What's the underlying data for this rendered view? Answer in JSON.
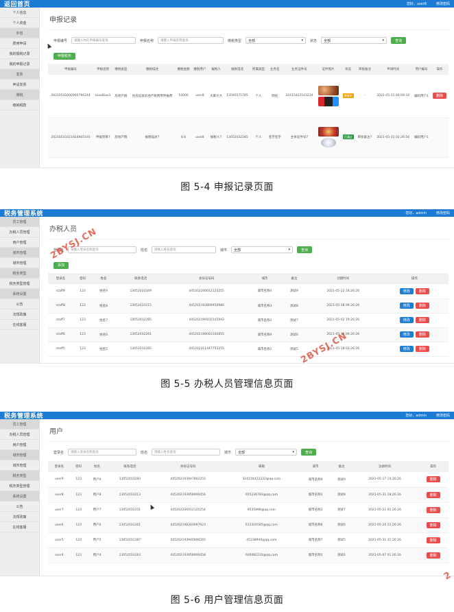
{
  "shot1": {
    "title": "返回首页",
    "top_right": [
      "您好，user8",
      "修改密码"
    ],
    "sidebar": [
      {
        "label": "个人信息",
        "group": false
      },
      {
        "label": "个人资金",
        "group": false
      },
      {
        "label": "外包",
        "group": true
      },
      {
        "label": "费用申请",
        "group": false
      },
      {
        "label": "我的报税记录",
        "group": false
      },
      {
        "label": "我的申报记录",
        "group": false
      },
      {
        "label": "发票",
        "group": true
      },
      {
        "label": "申请发票",
        "group": false
      },
      {
        "label": "缴税",
        "group": true
      },
      {
        "label": "缴纳税款",
        "group": false
      }
    ],
    "page_title": "申报记录",
    "filters": {
      "f1_label": "申报编号",
      "f1_placeholder": "请输入你的申报编号查询",
      "f2_label": "申报名称",
      "f2_placeholder": "请输入申报名称查询",
      "f3_label": "缴税类型",
      "f3_value": "全部",
      "f4_label": "状态",
      "f4_value": "全部",
      "search_label": "查询",
      "add_label": "申报税务"
    },
    "columns": [
      "申报编号",
      "申报名称",
      "缴税类型",
      "缴税描述",
      "缴税金额",
      "缴税用户",
      "报税人",
      "报税电话",
      "所属类型",
      "业务名",
      "业务证件号",
      "证件照片",
      "状态",
      "审核备注",
      "申请时间",
      "用户编号",
      "操作"
    ],
    "rows": [
      {
        "cells": [
          "20210531000900790244",
          "biaoBiao1",
          "房地产税",
          "住房征收房地产税费用申报费",
          "10000",
          "user8",
          "大麻大大",
          "13595575785",
          "个人",
          "网名",
          "32415422543234",
          "",
          "",
          "-",
          "2021-05-31 00:09:34",
          "编码用户1",
          ""
        ],
        "images": [
          "th-food",
          "th-console"
        ],
        "status": "审核中",
        "status_class": "tag-orange",
        "ops": [
          "删除"
        ]
      },
      {
        "cells": [
          "20210531021924905193",
          "申报项目7",
          "房地产税",
          "报税描述7",
          "6.6",
          "user8",
          "报税人7",
          "13052032285",
          "个人",
          "名字名字",
          "主体证件号7",
          "",
          "",
          "审核备注7",
          "2021-05-31 02:26:56",
          "编码用户1",
          ""
        ],
        "images": [
          "th-pizza",
          "th-plate"
        ],
        "status": "已通过",
        "status_class": "tag-green",
        "ops": []
      }
    ]
  },
  "shot2": {
    "title": "税务管理系统",
    "top_right": [
      "您好，admin",
      "修改密码"
    ],
    "sidebar": [
      {
        "label": "员工管理",
        "group": true
      },
      {
        "label": "办税人员管理",
        "group": false
      },
      {
        "label": "用户管理",
        "group": false
      },
      {
        "label": "城市管理",
        "group": true
      },
      {
        "label": "城市管理",
        "group": false
      },
      {
        "label": "税务类型",
        "group": true
      },
      {
        "label": "税务类型管理",
        "group": false
      },
      {
        "label": "系统设置",
        "group": true
      },
      {
        "label": "公告",
        "group": false
      },
      {
        "label": "法规政策",
        "group": false
      },
      {
        "label": "在线客服",
        "group": false
      }
    ],
    "page_title": "办税人员",
    "filters": {
      "f1_label": "登录名",
      "f1_placeholder": "请输入登录名称查询",
      "f2_label": "姓名",
      "f2_placeholder": "请输入姓名查询",
      "f3_label": "城市",
      "f3_value": "全部",
      "search_label": "查询",
      "add_label": "添加"
    },
    "columns": [
      "登录名",
      "密码",
      "姓名",
      "联系电话",
      "身份证号码",
      "城市",
      "备注",
      "创建时间",
      "操作"
    ],
    "rows": [
      [
        "staff9",
        "123",
        "姓名9",
        "13052033349",
        "445202200012125255",
        "城市名称4",
        "测试9",
        "2021-05-22 18:26:26"
      ],
      [
        "staff8",
        "123",
        "姓名8",
        "13052033215",
        "445202193809450980",
        "城市名称3",
        "测试8",
        "2021-05-18 09:26:26"
      ],
      [
        "staff7",
        "123",
        "姓名7",
        "13052032285",
        "445202199102145943",
        "城市名称2",
        "测试7",
        "2021-05-02 19:26:26"
      ],
      [
        "staff6",
        "123",
        "姓名6",
        "13052032261",
        "445202198003102855",
        "城市名称9",
        "测试6",
        "2021-05-16 09:26:26"
      ],
      [
        "staff5",
        "123",
        "姓名5",
        "13052032285",
        "445202211447753255",
        "城市名称1",
        "测试5",
        "2021-05-18 02:26:26"
      ]
    ],
    "ops": [
      "修改",
      "删除"
    ]
  },
  "shot3": {
    "title": "税务管理系统",
    "top_right": [
      "您好，admin",
      "修改密码"
    ],
    "sidebar": [
      {
        "label": "员工管理",
        "group": true
      },
      {
        "label": "办税人员管理",
        "group": false
      },
      {
        "label": "用户管理",
        "group": false
      },
      {
        "label": "城市管理",
        "group": true
      },
      {
        "label": "城市管理",
        "group": false
      },
      {
        "label": "税务类型",
        "group": true
      },
      {
        "label": "税务类型管理",
        "group": false
      },
      {
        "label": "系统设置",
        "group": true
      },
      {
        "label": "公告",
        "group": false
      },
      {
        "label": "法规政策",
        "group": false
      },
      {
        "label": "在线客服",
        "group": false
      }
    ],
    "page_title": "用户",
    "filters": {
      "f1_label": "登录名",
      "f1_placeholder": "请输入登录名称查询",
      "f2_label": "姓名",
      "f2_placeholder": "请输入姓名查询",
      "f3_label": "城市",
      "f3_value": "全部",
      "search_label": "查询"
    },
    "columns": [
      "登录名",
      "密码",
      "姓名",
      "联系电话",
      "身份证号码",
      "邮箱",
      "城市",
      "备注",
      "注册时间",
      "操作"
    ],
    "rows": [
      [
        "user9",
        "123",
        "用户9",
        "13052033283",
        "445202193947802255",
        "324234422222@qq.com",
        "城市名称9",
        "测试9",
        "2021-05-17 14:26:26"
      ],
      [
        "user8",
        "123",
        "用户8",
        "13052033213",
        "445202193958900456",
        "655236783@qq.com",
        "城市名称3",
        "测试8",
        "2021-05-31 18:26:26"
      ],
      [
        "user7",
        "123",
        "用户7",
        "13052032251",
        "445202200012125254",
        "9535898@qq.com",
        "城市名称3",
        "测试7",
        "2021-05-22 01:26:26"
      ],
      [
        "user6",
        "123",
        "用户6",
        "13052031261",
        "445202198303097923",
        "612316585@qq.com",
        "城市名称6",
        "测试6",
        "2021-05-20 21:26:26"
      ],
      [
        "user5",
        "123",
        "用户5",
        "13052031287",
        "445202193940890345",
        "45238940@qq.com",
        "城市名称7",
        "测试5",
        "2021-05-31 11:26:26"
      ],
      [
        "user4",
        "123",
        "用户4",
        "13052033183",
        "445202193958900458",
        "600082220@qq.com",
        "城市名称3",
        "测试4",
        "2021-05-07 01:26:26"
      ]
    ],
    "ops": [
      "删除"
    ]
  },
  "captions": {
    "c1": "图 5-4 申报记录页面",
    "c2": "图 5-5 办税人员管理信息页面",
    "c3": "图 5-6 用户管理信息页面"
  },
  "watermark": "2BYSJ.CN",
  "watermark_partial": "2",
  "colors": {
    "brand_blue": "#1d7bd4",
    "search_green": "#4cae4c",
    "delete_red": "#e84c4c",
    "edit_blue": "#1e7fd4"
  }
}
